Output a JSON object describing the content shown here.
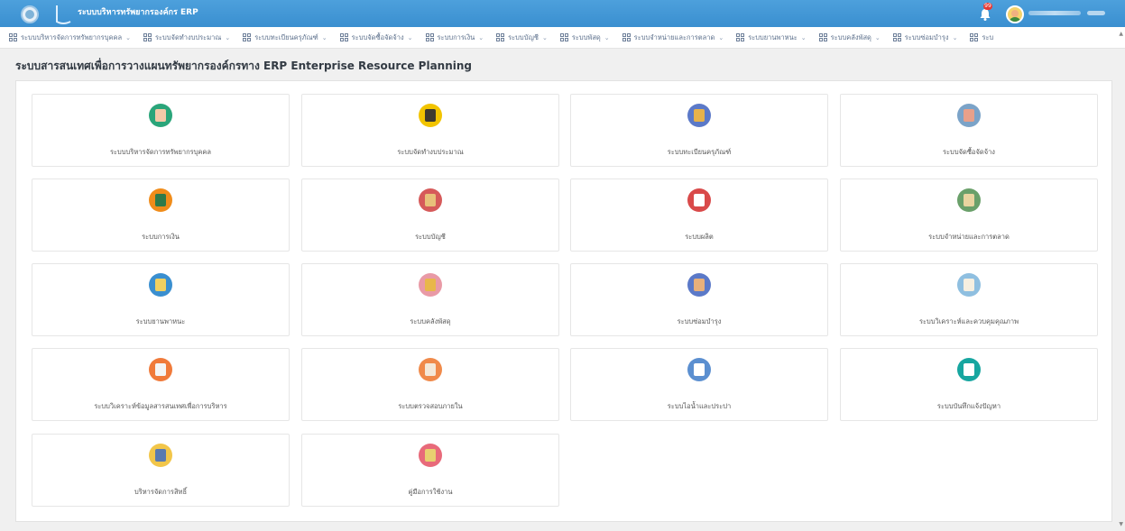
{
  "header": {
    "app_title": "ระบบบริหารทรัพยากรองค์กร ERP",
    "notification_count": "99"
  },
  "menu": [
    {
      "label": "ระบบบริหารจัดการทรัพยากรบุคคล"
    },
    {
      "label": "ระบบจัดทำงบประมาณ"
    },
    {
      "label": "ระบบทะเบียนครุภัณฑ์"
    },
    {
      "label": "ระบบจัดซื้อจัดจ้าง"
    },
    {
      "label": "ระบบการเงิน"
    },
    {
      "label": "ระบบบัญชี"
    },
    {
      "label": "ระบบพัสดุ"
    },
    {
      "label": "ระบบจำหน่ายและการตลาด"
    },
    {
      "label": "ระบบยานพาหนะ"
    },
    {
      "label": "ระบบคลังพัสดุ"
    },
    {
      "label": "ระบบซ่อมบำรุง"
    },
    {
      "label": "ระบ"
    }
  ],
  "page": {
    "title": "ระบบสารสนเทศเพื่อการวางแผนทรัพยากรองค์กรทาง ERP Enterprise Resource Planning"
  },
  "cards": [
    {
      "label": "ระบบบริหารจัดการทรัพยากรบุคคล",
      "icon": "people-icon",
      "color": "#2aa57a",
      "glyph": "#f3c9a8"
    },
    {
      "label": "ระบบจัดทำงบประมาณ",
      "icon": "briefcase-icon",
      "color": "#f2c400",
      "glyph": "#3e3a2f"
    },
    {
      "label": "ระบบทะเบียนครุภัณฑ์",
      "icon": "box-icon",
      "color": "#5b79c8",
      "glyph": "#e7b24a"
    },
    {
      "label": "ระบบจัดซื้อจัดจ้าง",
      "icon": "handshake-icon",
      "color": "#7ba3c8",
      "glyph": "#e8a08a"
    },
    {
      "label": "ระบบการเงิน",
      "icon": "money-bag-icon",
      "color": "#f08c1a",
      "glyph": "#2f7a4a"
    },
    {
      "label": "ระบบบัญชี",
      "icon": "ledger-icon",
      "color": "#d65a5a",
      "glyph": "#e8c07a"
    },
    {
      "label": "ระบบผลิต",
      "icon": "factory-icon",
      "color": "#d94a4a",
      "glyph": "#ffffff"
    },
    {
      "label": "ระบบจำหน่ายและการตลาด",
      "icon": "sales-icon",
      "color": "#6aa06a",
      "glyph": "#e9d4a0"
    },
    {
      "label": "ระบบยานพาหนะ",
      "icon": "vehicle-icon",
      "color": "#3a8fd0",
      "glyph": "#f0d060"
    },
    {
      "label": "ระบบคลังพัสดุ",
      "icon": "warehouse-icon",
      "color": "#e99aa6",
      "glyph": "#e8b74a"
    },
    {
      "label": "ระบบซ่อมบำรุง",
      "icon": "maintenance-icon",
      "color": "#5b79c8",
      "glyph": "#e8b07a"
    },
    {
      "label": "ระบบวิเคราะห์และควบคุมคุณภาพ",
      "icon": "book-icon",
      "color": "#8fbfe0",
      "glyph": "#f6efe0"
    },
    {
      "label": "ระบบวิเคราะห์ข้อมูลสารสนเทศเพื่อการบริหาร",
      "icon": "report-icon",
      "color": "#f07a3a",
      "glyph": "#f4f4f4"
    },
    {
      "label": "ระบบตรวจสอบภายใน",
      "icon": "audit-icon",
      "color": "#f08a4a",
      "glyph": "#f4e8d8"
    },
    {
      "label": "ระบบไอน้ำและประปา",
      "icon": "water-icon",
      "color": "#5b8fd0",
      "glyph": "#ffffff"
    },
    {
      "label": "ระบบบันทึกแจ้งปัญหา",
      "icon": "note-icon",
      "color": "#17a6a0",
      "glyph": "#ffffff"
    },
    {
      "label": "บริหารจัดการสิทธิ์",
      "icon": "users-admin-icon",
      "color": "#f2c64a",
      "glyph": "#5a7ab0"
    },
    {
      "label": "คู่มือการใช้งาน",
      "icon": "manual-icon",
      "color": "#e86a7a",
      "glyph": "#e8d070"
    }
  ]
}
